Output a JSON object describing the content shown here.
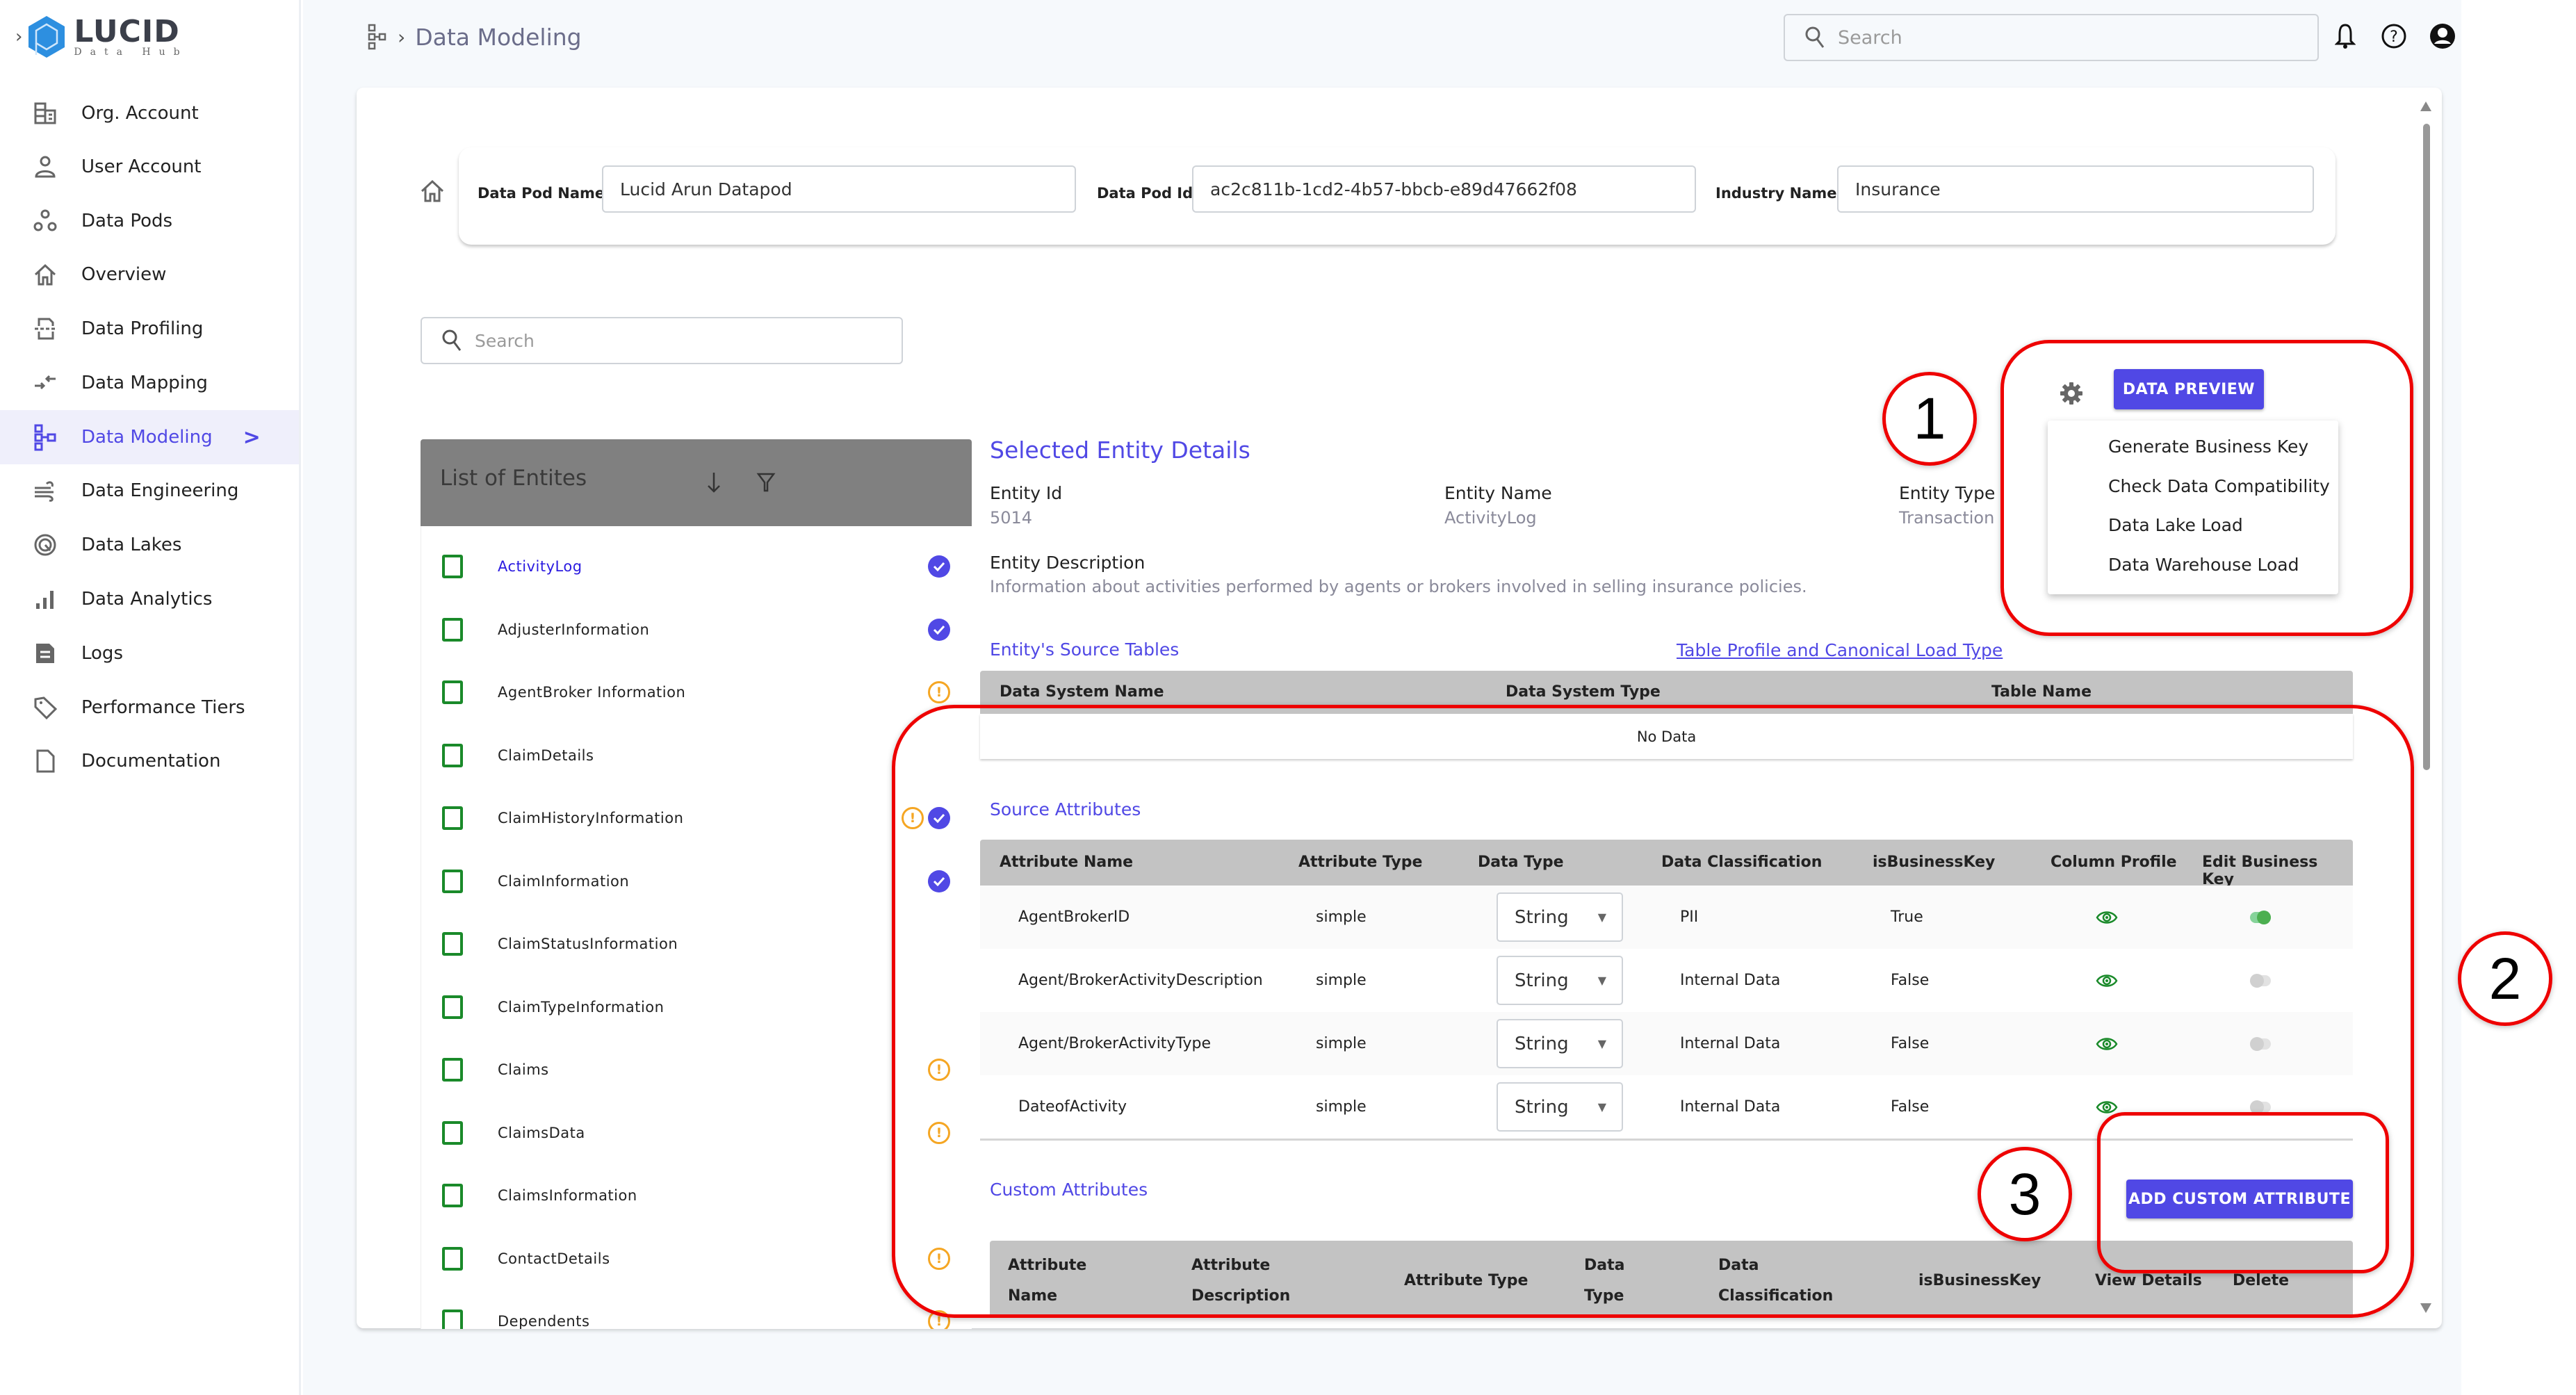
{
  "app": {
    "logo_title": "LUCID",
    "logo_subtitle": "Data Hub",
    "expand_chevron": "›"
  },
  "sidebar": {
    "items": [
      {
        "label": "Org. Account",
        "icon": "building-icon"
      },
      {
        "label": "User Account",
        "icon": "user-icon"
      },
      {
        "label": "Data Pods",
        "icon": "pods-icon"
      },
      {
        "label": "Overview",
        "icon": "home-icon"
      },
      {
        "label": "Data Profiling",
        "icon": "profiling-icon"
      },
      {
        "label": "Data Mapping",
        "icon": "mapping-icon"
      },
      {
        "label": "Data Modeling",
        "icon": "modeling-icon",
        "active": true,
        "arrow": ">"
      },
      {
        "label": "Data Engineering",
        "icon": "wind-icon"
      },
      {
        "label": "Data Lakes",
        "icon": "lakes-icon"
      },
      {
        "label": "Data Analytics",
        "icon": "bar-chart-icon"
      },
      {
        "label": "Logs",
        "icon": "document-icon"
      },
      {
        "label": "Performance Tiers",
        "icon": "tag-icon"
      },
      {
        "label": "Documentation",
        "icon": "file-icon"
      }
    ]
  },
  "header": {
    "breadcrumb_separator": "›",
    "breadcrumb_current": "Data Modeling",
    "search_placeholder": "Search"
  },
  "pod": {
    "name_label": "Data Pod Name",
    "name_value": "Lucid Arun Datapod",
    "id_label": "Data Pod Id",
    "id_value": "ac2c811b-1cd2-4b57-bbcb-e89d47662f08",
    "industry_label": "Industry Name",
    "industry_value": "Insurance"
  },
  "entity_search": {
    "placeholder": "Search"
  },
  "entity_list": {
    "title": "List of Entites",
    "items": [
      {
        "name": "ActivityLog",
        "selected": true,
        "status": [
          "check"
        ]
      },
      {
        "name": "AdjusterInformation",
        "status": [
          "check"
        ]
      },
      {
        "name": "AgentBroker Information",
        "status": [
          "warning"
        ]
      },
      {
        "name": "ClaimDetails",
        "status": []
      },
      {
        "name": "ClaimHistoryInformation",
        "status": [
          "warning",
          "check"
        ]
      },
      {
        "name": "ClaimInformation",
        "status": [
          "check"
        ]
      },
      {
        "name": "ClaimStatusInformation",
        "status": []
      },
      {
        "name": "ClaimTypeInformation",
        "status": []
      },
      {
        "name": "Claims",
        "status": [
          "warning"
        ]
      },
      {
        "name": "ClaimsData",
        "status": [
          "warning"
        ]
      },
      {
        "name": "ClaimsInformation",
        "status": []
      },
      {
        "name": "ContactDetails",
        "status": [
          "warning"
        ]
      },
      {
        "name": "Dependents",
        "status": [
          "warning"
        ]
      }
    ]
  },
  "details": {
    "title": "Selected Entity Details",
    "entity_id_label": "Entity Id",
    "entity_id": "5014",
    "entity_name_label": "Entity Name",
    "entity_name": "ActivityLog",
    "entity_type_label": "Entity Type",
    "entity_type": "Transaction",
    "description_label": "Entity Description",
    "description": "Information about activities performed by agents or brokers involved in selling insurance policies."
  },
  "actions": {
    "data_preview": "DATA PREVIEW",
    "menu": [
      "Generate Business Key",
      "Check Data Compatibility",
      "Data Lake Load",
      "Data Warehouse Load"
    ]
  },
  "source_tables": {
    "title": "Entity's Source Tables",
    "link": "Table Profile and Canonical Load Type",
    "columns": [
      "Data System Name",
      "Data System Type",
      "Table Name"
    ],
    "empty": "No Data"
  },
  "source_attributes": {
    "title": "Source Attributes",
    "columns": [
      "Attribute Name",
      "Attribute Type",
      "Data Type",
      "Data Classification",
      "isBusinessKey",
      "Column Profile",
      "Edit Business Key"
    ],
    "rows": [
      {
        "name": "AgentBrokerID",
        "type": "simple",
        "data_type": "String",
        "classification": "PII",
        "is_business_key": "True",
        "edit_key_on": true
      },
      {
        "name": "Agent/BrokerActivityDescription",
        "type": "simple",
        "data_type": "String",
        "classification": "Internal Data",
        "is_business_key": "False",
        "edit_key_on": false
      },
      {
        "name": "Agent/BrokerActivityType",
        "type": "simple",
        "data_type": "String",
        "classification": "Internal Data",
        "is_business_key": "False",
        "edit_key_on": false
      },
      {
        "name": "DateofActivity",
        "type": "simple",
        "data_type": "String",
        "classification": "Internal Data",
        "is_business_key": "False",
        "edit_key_on": false
      }
    ]
  },
  "custom_attributes": {
    "title": "Custom Attributes",
    "add_button": "ADD CUSTOM ATTRIBUTE",
    "columns": [
      {
        "line1": "Attribute",
        "line2": "Name"
      },
      {
        "line1": "Attribute",
        "line2": "Description"
      },
      {
        "line1": "Attribute Type",
        "line2": ""
      },
      {
        "line1": "Data",
        "line2": "Type"
      },
      {
        "line1": "Data",
        "line2": "Classification"
      },
      {
        "line1": "isBusinessKey",
        "line2": ""
      },
      {
        "line1": "View Details",
        "line2": ""
      },
      {
        "line1": "Delete",
        "line2": ""
      }
    ]
  },
  "annotations": [
    "1",
    "2",
    "3"
  ],
  "colors": {
    "accent": "#5048e5",
    "warning": "#f5a623",
    "success": "#1a8a2a",
    "annotation": "#ee0000"
  }
}
